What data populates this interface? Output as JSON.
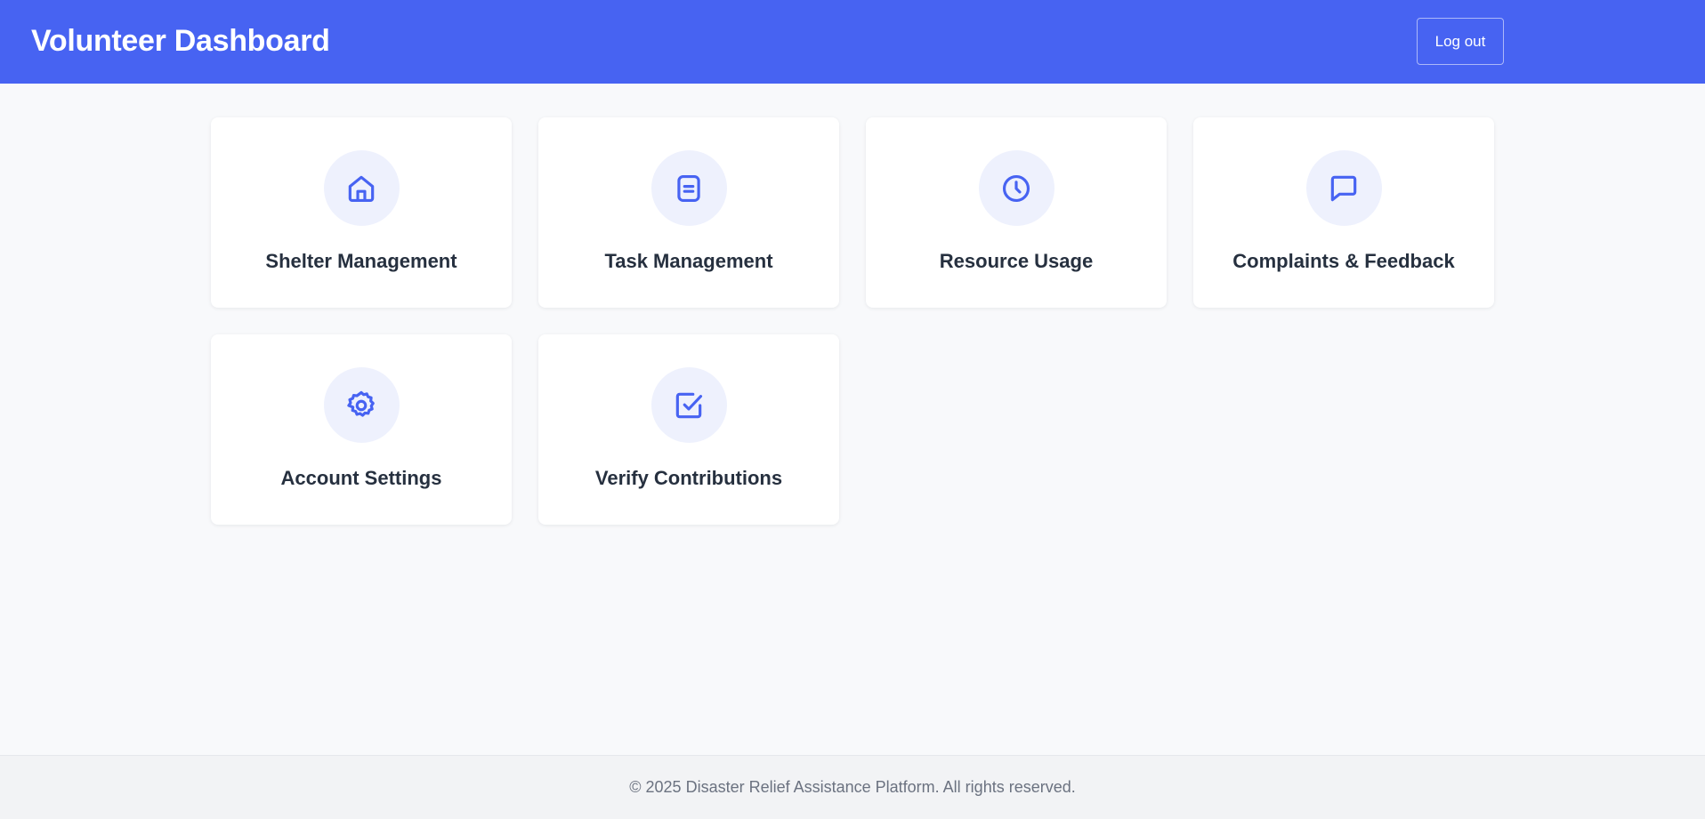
{
  "header": {
    "title": "Volunteer Dashboard",
    "logout_label": "Log out"
  },
  "cards": [
    {
      "label": "Shelter Management",
      "icon": "home-icon"
    },
    {
      "label": "Task Management",
      "icon": "list-icon"
    },
    {
      "label": "Resource Usage",
      "icon": "clock-icon"
    },
    {
      "label": "Complaints & Feedback",
      "icon": "message-icon"
    },
    {
      "label": "Account Settings",
      "icon": "gear-icon"
    },
    {
      "label": "Verify Contributions",
      "icon": "check-square-icon"
    }
  ],
  "footer": {
    "text": "© 2025 Disaster Relief Assistance Platform. All rights reserved."
  },
  "colors": {
    "header_bg": "#4763f2",
    "accent": "#4763f2",
    "icon_circle_bg": "#eef1fd",
    "card_text": "#26303f",
    "page_bg": "#f8f9fb"
  }
}
